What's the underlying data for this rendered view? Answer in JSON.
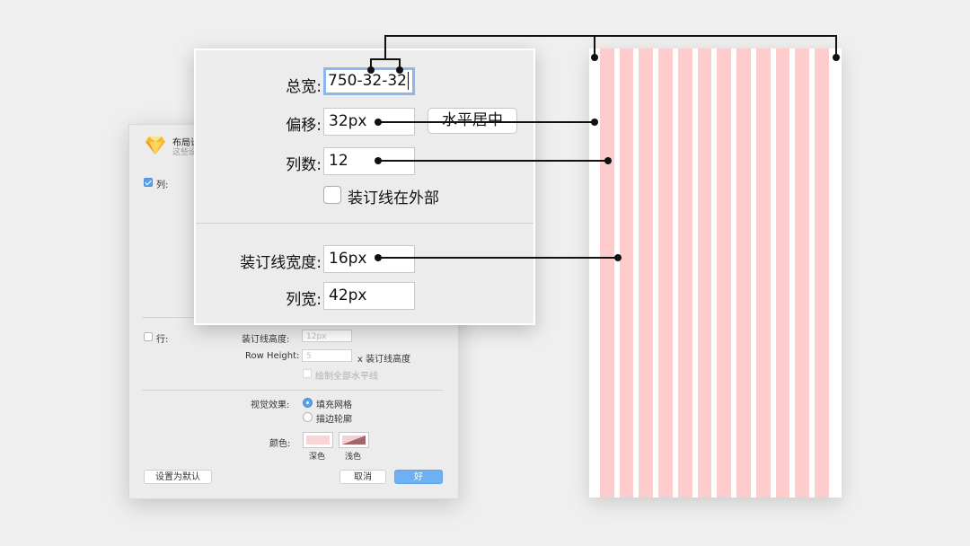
{
  "back_dialog": {
    "title": "布局设",
    "subtitle": "这些设",
    "columns_label": "列:",
    "columns_checked": true,
    "rows_label": "行:",
    "rows_checked": false,
    "gutter_height_label": "装订线高度:",
    "gutter_height_value": "12px",
    "row_height_label": "Row Height:",
    "row_height_value": "5",
    "row_height_suffix": "x 装订线高度",
    "draw_all_label": "绘制全部水平线",
    "visual_label": "视觉效果:",
    "fill_grid_label": "填充网格",
    "stroke_outline_label": "描边轮廓",
    "visual_selected": "填充网格",
    "color_label": "颜色:",
    "dark_label": "深色",
    "light_label": "浅色",
    "dark_color": "#f9d6d6",
    "light_color": "#a06868",
    "set_default_button": "设置为默认",
    "cancel_button": "取消",
    "ok_button": "好"
  },
  "front_dialog": {
    "total_width_label": "总宽:",
    "total_width_value": "750-32-32",
    "offset_label": "偏移:",
    "offset_value": "32px",
    "center_button": "水平居中",
    "columns_label": "列数:",
    "columns_value": "12",
    "gutter_outside_label": "装订线在外部",
    "gutter_outside_checked": false,
    "gutter_width_label": "装订线宽度:",
    "gutter_width_value": "16px",
    "column_width_label": "列宽:",
    "column_width_value": "42px"
  },
  "preview": {
    "column_count": 12,
    "offset": 32,
    "column_width": 42,
    "gutter_width": 16,
    "total_width": 750,
    "column_color": "#fecccc",
    "background_color": "#ffffff"
  },
  "colors": {
    "accent": "#5aa0ea",
    "focus_ring": "#8ab8ee",
    "annotation_line": "#111111"
  }
}
